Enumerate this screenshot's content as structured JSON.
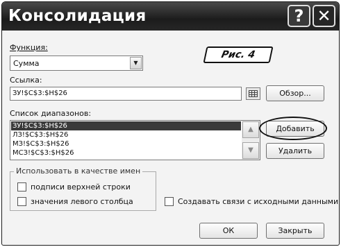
{
  "dialog": {
    "title": "Консолидация",
    "help_glyph": "?",
    "close_glyph": "✕"
  },
  "function": {
    "label": "Функция:",
    "selected": "Сумма"
  },
  "figure_tag": "Рис. 4",
  "reference": {
    "label": "Ссылка:",
    "value": "ЗУ!$C$3:$H$26",
    "browse_label": "Обзор..."
  },
  "ranges": {
    "label": "Список диапазонов:",
    "items": [
      "ЗУ!$C$3:$H$26",
      "ЛЗ!$C$3:$H$26",
      "МЗ!$C$3:$H$26",
      "МСЗ!$C$3:$H$26"
    ],
    "selected_index": 0
  },
  "buttons": {
    "add": "Добавить",
    "delete": "Удалить",
    "ok": "ОК",
    "close": "Закрыть"
  },
  "names_group": {
    "legend": "Использовать в качестве имен",
    "top_row": "подписи верхней строки",
    "left_column": "значения левого столбца"
  },
  "create_links": "Создавать связи с исходными данными"
}
